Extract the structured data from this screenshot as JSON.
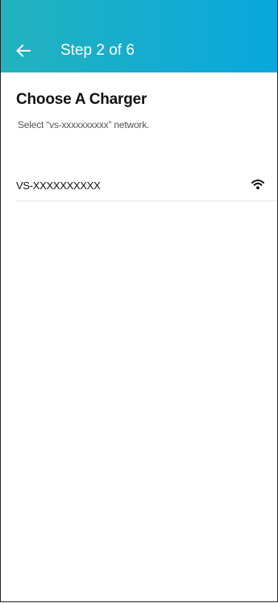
{
  "appbar": {
    "back_icon": "arrow-left-icon",
    "title": "Step 2 of 6",
    "colors": {
      "start": "#23b3bd",
      "end": "#08a8dd",
      "text": "#ffffff"
    }
  },
  "main": {
    "heading": "Choose A Charger",
    "subheading": "Select “vs-xxxxxxxxxx” network.",
    "networks": [
      {
        "name": "VS-XXXXXXXXXX",
        "icon": "wifi-icon"
      }
    ]
  }
}
